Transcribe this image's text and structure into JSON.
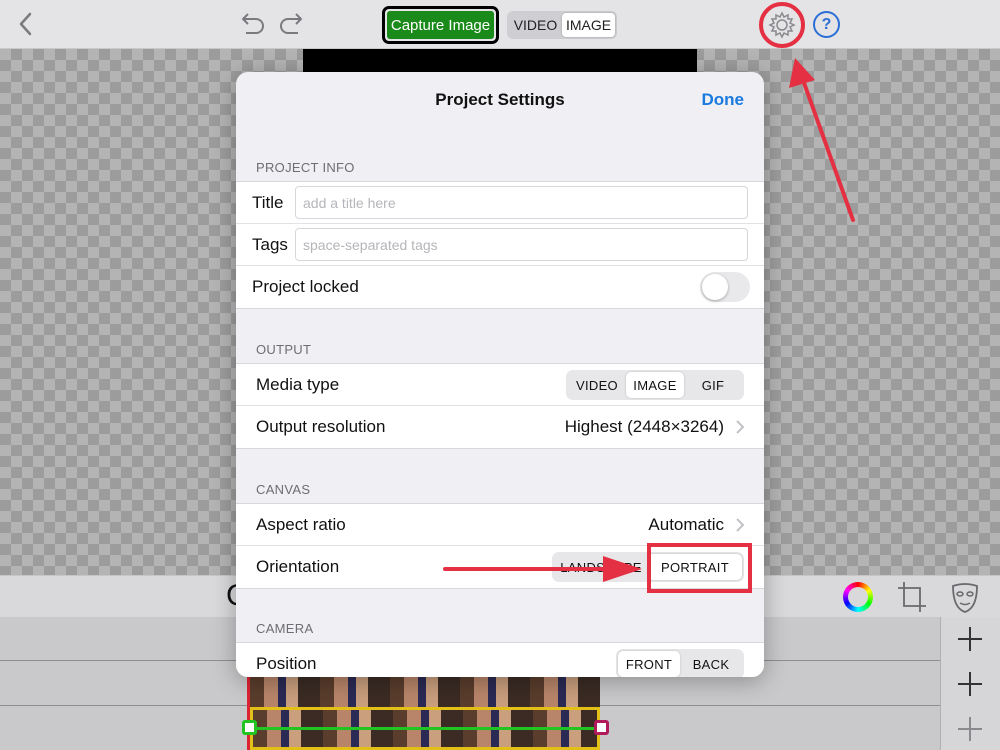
{
  "toolbar": {
    "capture_label": "Capture Image",
    "mode_options": [
      "VIDEO",
      "IMAGE"
    ],
    "mode_selected": "IMAGE",
    "help_label": "?"
  },
  "editor": {
    "mid_glyph": "C"
  },
  "modal": {
    "title": "Project Settings",
    "done_label": "Done",
    "project_info": {
      "section": "PROJECT INFO",
      "title_label": "Title",
      "title_placeholder": "add a title here",
      "tags_label": "Tags",
      "tags_placeholder": "space-separated tags",
      "locked_label": "Project locked",
      "locked_value": false
    },
    "output": {
      "section": "OUTPUT",
      "media_type_label": "Media type",
      "media_options": [
        "VIDEO",
        "IMAGE",
        "GIF"
      ],
      "media_selected": "IMAGE",
      "resolution_label": "Output resolution",
      "resolution_value": "Highest (2448×3264)"
    },
    "canvas": {
      "section": "CANVAS",
      "aspect_label": "Aspect ratio",
      "aspect_value": "Automatic",
      "orientation_label": "Orientation",
      "orientation_options": [
        "LANDSCAPE",
        "PORTRAIT"
      ],
      "orientation_selected": "PORTRAIT"
    },
    "camera": {
      "section": "CAMERA",
      "position_label": "Position",
      "position_options": [
        "FRONT",
        "BACK"
      ],
      "position_selected": "FRONT"
    }
  },
  "colors": {
    "accent_blue": "#1a7ae0",
    "capture_green": "#1a8a1a",
    "annotation_red": "#e43042"
  }
}
